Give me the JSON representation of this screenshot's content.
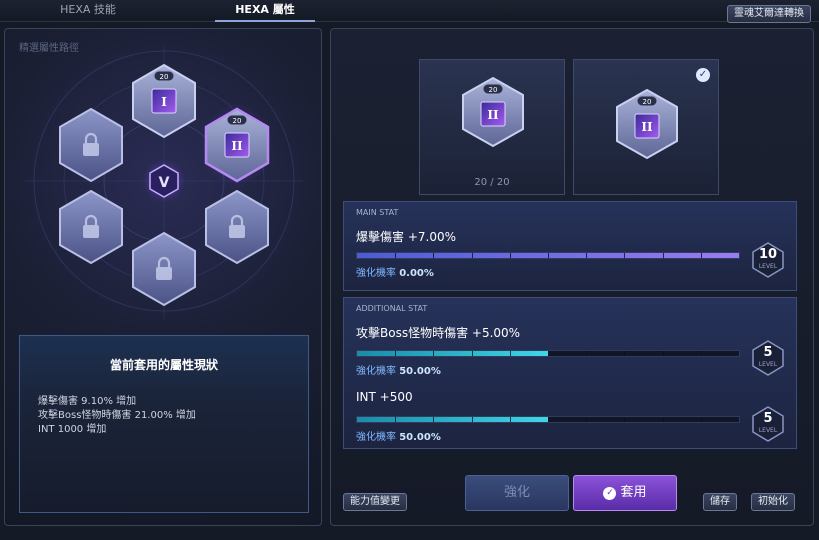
{
  "tabs": {
    "skill": "HEXA 技能",
    "attr": "HEXA 屬性"
  },
  "convert_button": "靈魂艾爾達轉換",
  "left_faint_label": "精選屬性路徑",
  "hex_board": {
    "center_symbol": "V",
    "slots": [
      {
        "pos": "top",
        "state": "core",
        "level": "20"
      },
      {
        "pos": "upper-right",
        "state": "core-active",
        "level": "20"
      },
      {
        "pos": "upper-left",
        "state": "locked"
      },
      {
        "pos": "lower-left",
        "state": "locked"
      },
      {
        "pos": "lower-right",
        "state": "locked"
      },
      {
        "pos": "bottom",
        "state": "locked"
      }
    ]
  },
  "status": {
    "title": "當前套用的屬性現狀",
    "lines": [
      "爆擊傷害 9.10% 增加",
      "攻擊Boss怪物時傷害 21.00% 增加",
      "INT 1000 增加"
    ]
  },
  "cores": [
    {
      "level": "20",
      "count": "20 / 20",
      "checked": false
    },
    {
      "level": "20",
      "count": "",
      "checked": true
    }
  ],
  "main_stat": {
    "label": "MAIN STAT",
    "name": "爆擊傷害 +7.00%",
    "chance_label": "強化機率",
    "chance_value": "0.00%",
    "level": "10",
    "level_word": "LEVEL",
    "progress": 1.0
  },
  "additional": {
    "label": "ADDITIONAL STAT",
    "stats": [
      {
        "name": "攻擊Boss怪物時傷害 +5.00%",
        "chance_label": "強化機率",
        "chance_value": "50.00%",
        "level": "5",
        "level_word": "LEVEL",
        "progress": 0.5
      },
      {
        "name": "INT +500",
        "chance_label": "強化機率",
        "chance_value": "50.00%",
        "level": "5",
        "level_word": "LEVEL",
        "progress": 0.5
      }
    ]
  },
  "buttons": {
    "change_stat": "能力值變更",
    "enhance": "強化",
    "apply": "套用",
    "save": "儲存",
    "reset": "初始化"
  },
  "colors": {
    "accent_purple": "#8a52d8",
    "cyan": "#3fd6e8",
    "blue_purple": "#6a6ae0"
  }
}
